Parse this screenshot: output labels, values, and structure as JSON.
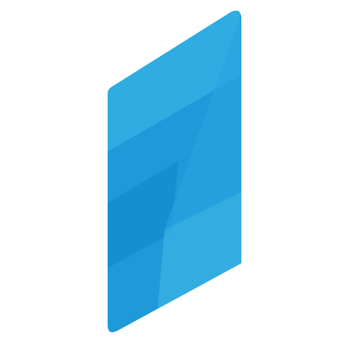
{
  "logo": {
    "icon": "isometric-blue-panel-icon",
    "colors": {
      "base": "#1e9ad8",
      "light": "#35b1e6",
      "mid": "#28a5df",
      "dark": "#0f86c8",
      "highlight": "#4cc0ec"
    }
  }
}
